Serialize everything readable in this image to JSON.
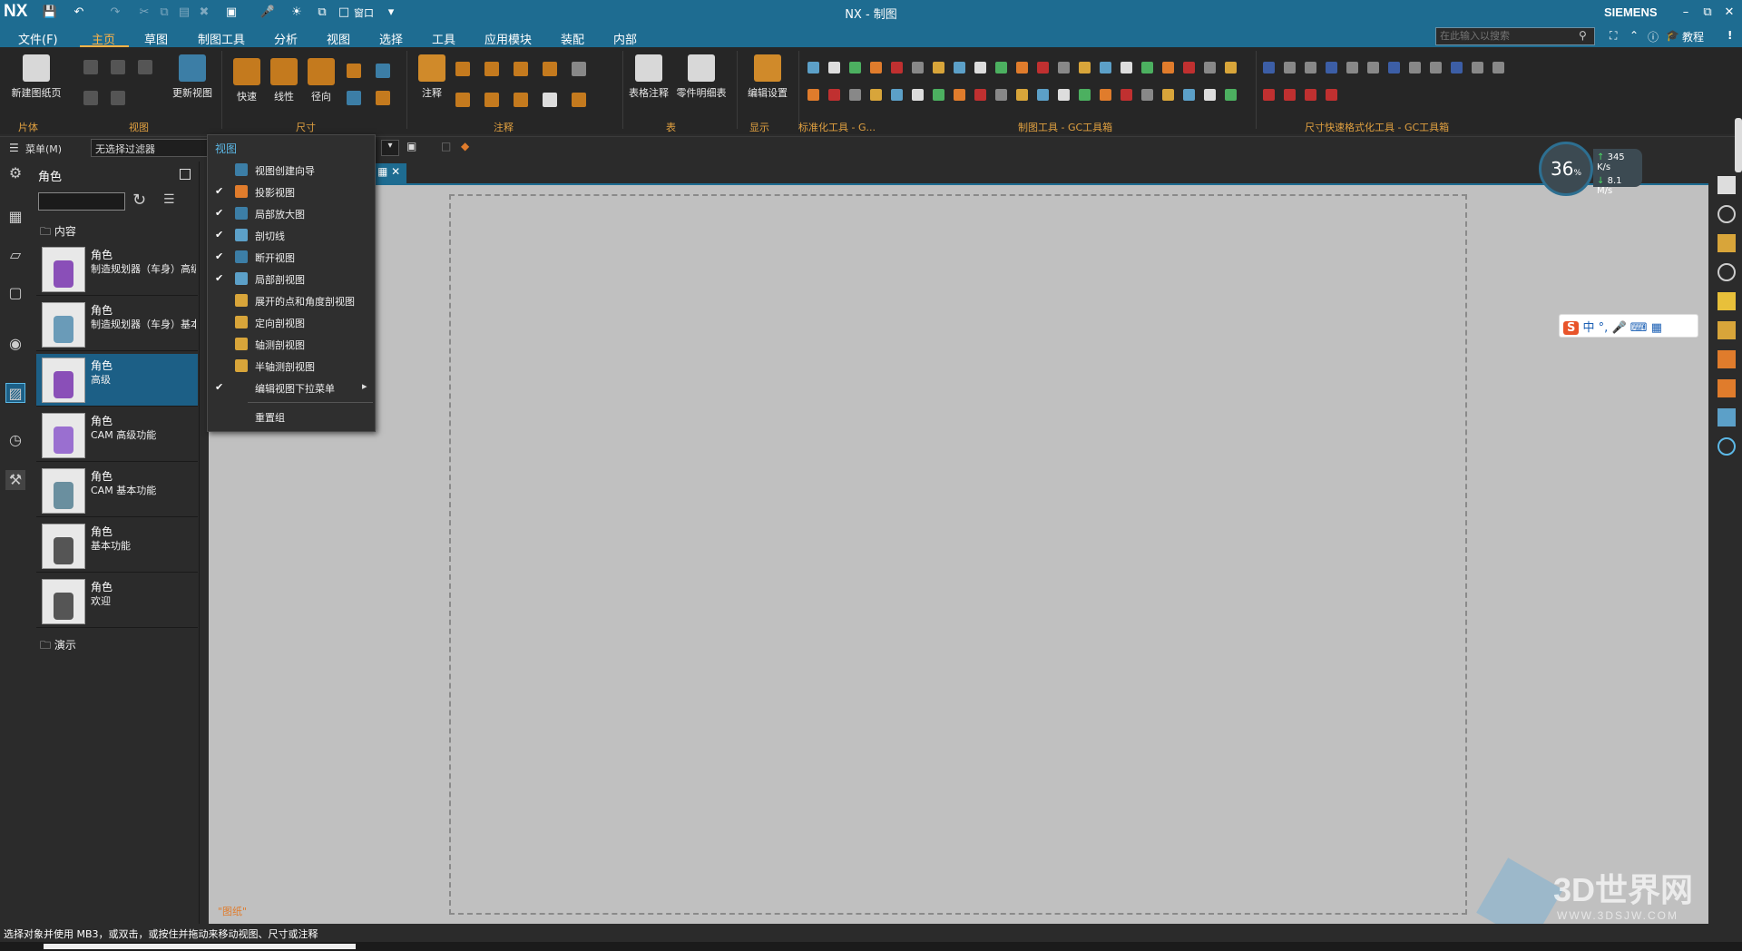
{
  "window": {
    "title": "NX - 制图",
    "logo": "NX",
    "brand": "SIEMENS",
    "window_menu": "窗口"
  },
  "menu": {
    "items": [
      "文件(F)",
      "主页",
      "草图",
      "制图工具",
      "分析",
      "视图",
      "选择",
      "工具",
      "应用模块",
      "装配",
      "内部"
    ],
    "active_index": 1
  },
  "search": {
    "placeholder": "在此输入以搜索"
  },
  "help": {
    "tutorial": "教程"
  },
  "ribbon": {
    "buttons": {
      "new_sheet": "新建图纸页",
      "update_view": "更新视图",
      "quick": "快速",
      "linear": "线性",
      "radial": "径向",
      "note": "注释",
      "table_note": "表格注释",
      "parts_list": "零件明细表",
      "edit_settings": "编辑设置"
    },
    "groups": [
      "片体",
      "视图",
      "尺寸",
      "注释",
      "表",
      "显示",
      "标准化工具 - G...",
      "制图工具 - GC工具箱",
      "尺寸快速格式化工具 - GC工具箱"
    ]
  },
  "toolbar2": {
    "menu_label": "菜单(M)",
    "filter_value": "无选择过滤器"
  },
  "panel": {
    "title": "角色",
    "folders": {
      "content": "内容",
      "demo": "演示"
    },
    "roles": [
      {
        "title": "角色",
        "desc": "制造规划器（车身）高级"
      },
      {
        "title": "角色",
        "desc": "制造规划器（车身）基本"
      },
      {
        "title": "角色",
        "desc": "高级"
      },
      {
        "title": "角色",
        "desc": "CAM 高级功能"
      },
      {
        "title": "角色",
        "desc": "CAM 基本功能"
      },
      {
        "title": "角色",
        "desc": "基本功能"
      },
      {
        "title": "角色",
        "desc": "欢迎"
      }
    ],
    "selected_index": 2
  },
  "dropdown": {
    "header": "视图",
    "items": [
      {
        "label": "视图创建向导",
        "checked": false
      },
      {
        "label": "投影视图",
        "checked": true
      },
      {
        "label": "局部放大图",
        "checked": true
      },
      {
        "label": "剖切线",
        "checked": true
      },
      {
        "label": "断开视图",
        "checked": true
      },
      {
        "label": "局部剖视图",
        "checked": true
      },
      {
        "label": "展开的点和角度剖视图",
        "checked": false
      },
      {
        "label": "定向剖视图",
        "checked": false
      },
      {
        "label": "轴测剖视图",
        "checked": false
      },
      {
        "label": "半轴测剖视图",
        "checked": false
      },
      {
        "label": "编辑视图下拉菜单",
        "checked": true,
        "submenu": true
      }
    ],
    "reset": "重置组"
  },
  "canvas": {
    "corner_text": "\"图纸\""
  },
  "netgauge": {
    "percent": "36",
    "unit": "%",
    "up": "345",
    "up_unit": "K/s",
    "down": "8.1",
    "down_unit": "M/s"
  },
  "ime": {
    "lang": "中"
  },
  "status": {
    "text": "选择对象并使用 MB3，或双击，或按住并拖动来移动视图、尺寸或注释"
  },
  "watermark": {
    "brand": "3D世界网",
    "url": "WWW.3DSJW.COM"
  },
  "colors": {
    "title_bar": "#1e6c91",
    "accent_tab": "#ffb347",
    "selected": "#1c5f86",
    "canvas": "#c0c0c0"
  }
}
